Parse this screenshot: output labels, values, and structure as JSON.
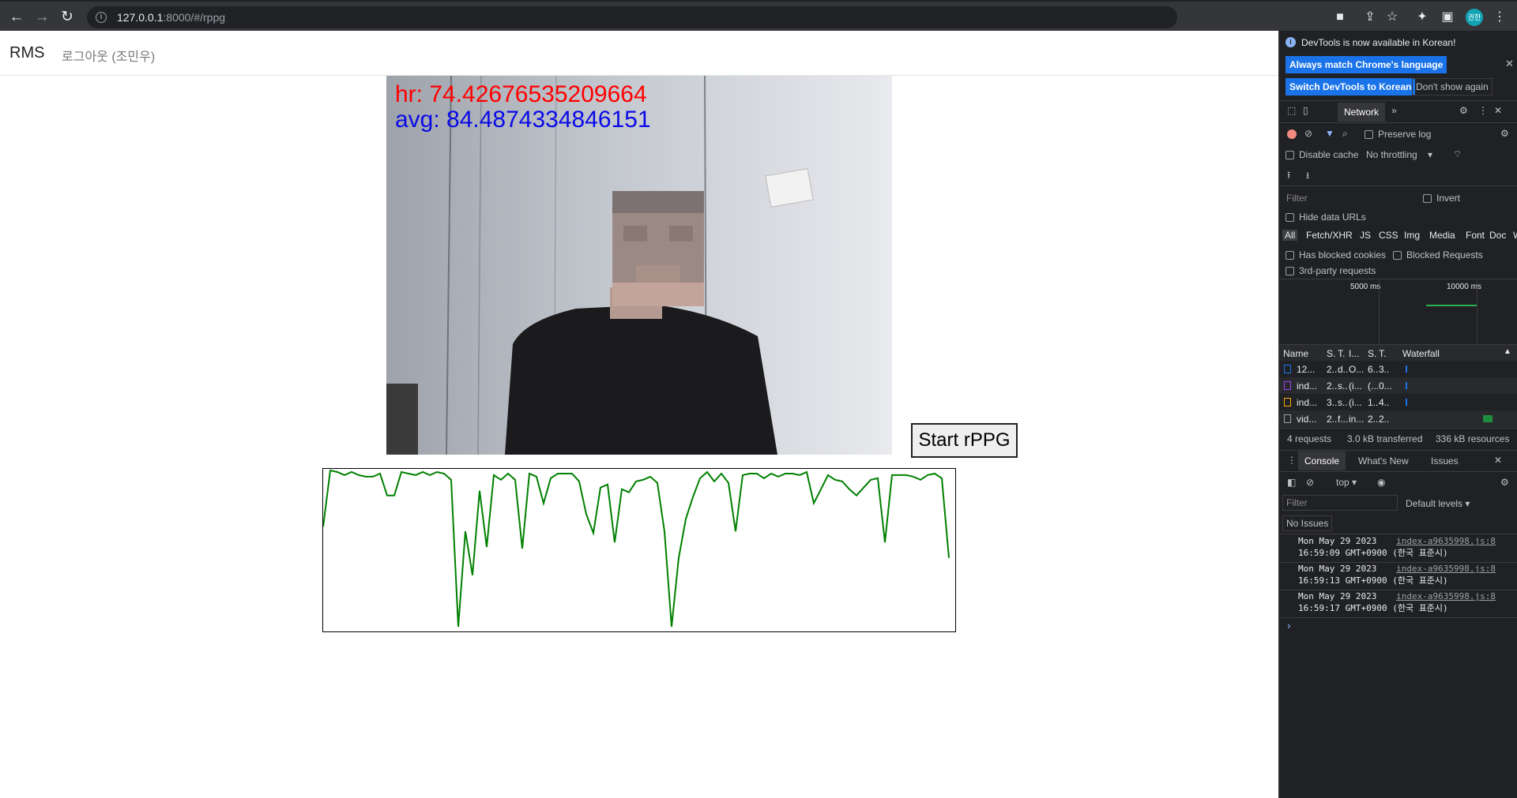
{
  "browser": {
    "url_host": "127.0.0.1",
    "url_path": ":8000/#/rppg",
    "avatar_text": "권한"
  },
  "navbar": {
    "brand": "RMS",
    "logout": "로그아웃 (조민우)"
  },
  "video": {
    "hr_text": "hr: 74.42676535209664",
    "avg_text": "avg: 84.4874334846151"
  },
  "start_button": "Start rPPG",
  "chart_data": {
    "type": "line",
    "x": [
      0,
      1,
      2,
      3,
      4,
      5,
      6,
      7,
      8,
      9,
      10,
      11,
      12,
      13,
      14,
      15,
      16,
      17,
      18,
      19,
      20,
      21,
      22,
      23,
      24,
      25,
      26,
      27,
      28,
      29,
      30,
      31,
      32,
      33,
      34,
      35,
      36,
      37,
      38,
      39,
      40,
      41,
      42,
      43,
      44,
      45,
      46,
      47,
      48,
      49,
      50,
      51,
      52,
      53,
      54,
      55,
      56,
      57,
      58,
      59,
      60,
      61,
      62,
      63,
      64,
      65,
      66,
      67,
      68,
      69,
      70,
      71,
      72,
      73,
      74,
      75,
      76,
      77,
      78,
      79,
      80,
      81,
      82,
      83,
      84,
      85,
      86,
      87,
      88,
      89,
      90,
      91,
      92,
      93,
      94,
      95,
      96
    ],
    "values": [
      0.64,
      1.0,
      0.99,
      0.97,
      0.99,
      0.97,
      0.96,
      0.96,
      0.98,
      0.84,
      0.84,
      0.99,
      0.98,
      0.97,
      0.99,
      0.97,
      0.99,
      0.98,
      0.94,
      0.0,
      0.61,
      0.33,
      0.87,
      0.51,
      0.97,
      0.94,
      0.98,
      0.94,
      0.5,
      0.98,
      0.96,
      0.79,
      0.95,
      0.98,
      0.98,
      0.98,
      0.93,
      0.72,
      0.6,
      0.89,
      0.91,
      0.54,
      0.88,
      0.86,
      0.93,
      0.94,
      0.96,
      0.92,
      0.61,
      0.0,
      0.44,
      0.69,
      0.83,
      0.95,
      0.99,
      0.93,
      0.98,
      0.92,
      0.61,
      0.97,
      0.98,
      0.98,
      0.95,
      0.98,
      0.96,
      0.98,
      0.98,
      0.97,
      0.99,
      0.79,
      0.88,
      0.97,
      0.94,
      0.93,
      0.88,
      0.84,
      0.89,
      0.94,
      0.95,
      0.54,
      0.97,
      0.97,
      0.97,
      0.96,
      0.94,
      0.97,
      0.98,
      0.95,
      0.44
    ],
    "ylim": [
      0,
      1
    ]
  },
  "colors": {
    "line": "#008000",
    "hr": "#ff0000",
    "avg": "#0a0ae6"
  },
  "devtools": {
    "notice": "DevTools is now available in Korean!",
    "btn_match": "Always match Chrome's language",
    "btn_switch": "Switch DevTools to Korean",
    "btn_dont_show": "Don't show again",
    "tab_network": "Network",
    "preserve_log": "Preserve log",
    "disable_cache": "Disable cache",
    "throttling": "No throttling",
    "filter_placeholder": "Filter",
    "invert": "Invert",
    "hide_data_urls": "Hide data URLs",
    "types": [
      "All",
      "Fetch/XHR",
      "JS",
      "CSS",
      "Img",
      "Media",
      "Font",
      "Doc",
      "W"
    ],
    "has_blocked_cookies": "Has blocked cookies",
    "blocked_requests": "Blocked Requests",
    "third_party": "3rd-party requests",
    "timeline_labels": [
      "5000 ms",
      "10000 ms"
    ],
    "table_headers": [
      "Name",
      "S.",
      "T.",
      "I...",
      "S.",
      "T.",
      "Waterfall"
    ],
    "rows": [
      [
        "12...",
        "2..",
        "d..",
        "O...",
        "6..",
        "3.."
      ],
      [
        "ind...",
        "2..",
        "s..",
        "(i...",
        "(...",
        "0..."
      ],
      [
        "ind...",
        "3..",
        "s..",
        "(i...",
        "1..",
        "4.."
      ],
      [
        "vid...",
        "2..",
        "f...",
        "in...",
        "2..",
        "2.."
      ]
    ],
    "summary": [
      "4 requests",
      "3.0 kB transferred",
      "336 kB resources"
    ],
    "drawer_tabs": [
      "Console",
      "What's New",
      "Issues"
    ],
    "context": "top",
    "console_filter": "Filter",
    "default_levels": "Default levels",
    "no_issues": "No Issues",
    "logs": [
      {
        "line1": "Mon May 29 2023",
        "line2": "16:59:09 GMT+0900 (한국 표준시)",
        "src": "index-a9635998.js:8"
      },
      {
        "line1": "Mon May 29 2023",
        "line2": "16:59:13 GMT+0900 (한국 표준시)",
        "src": "index-a9635998.js:8"
      },
      {
        "line1": "Mon May 29 2023",
        "line2": "16:59:17 GMT+0900 (한국 표준시)",
        "src": "index-a9635998.js:8"
      }
    ],
    "prompt": "›"
  }
}
